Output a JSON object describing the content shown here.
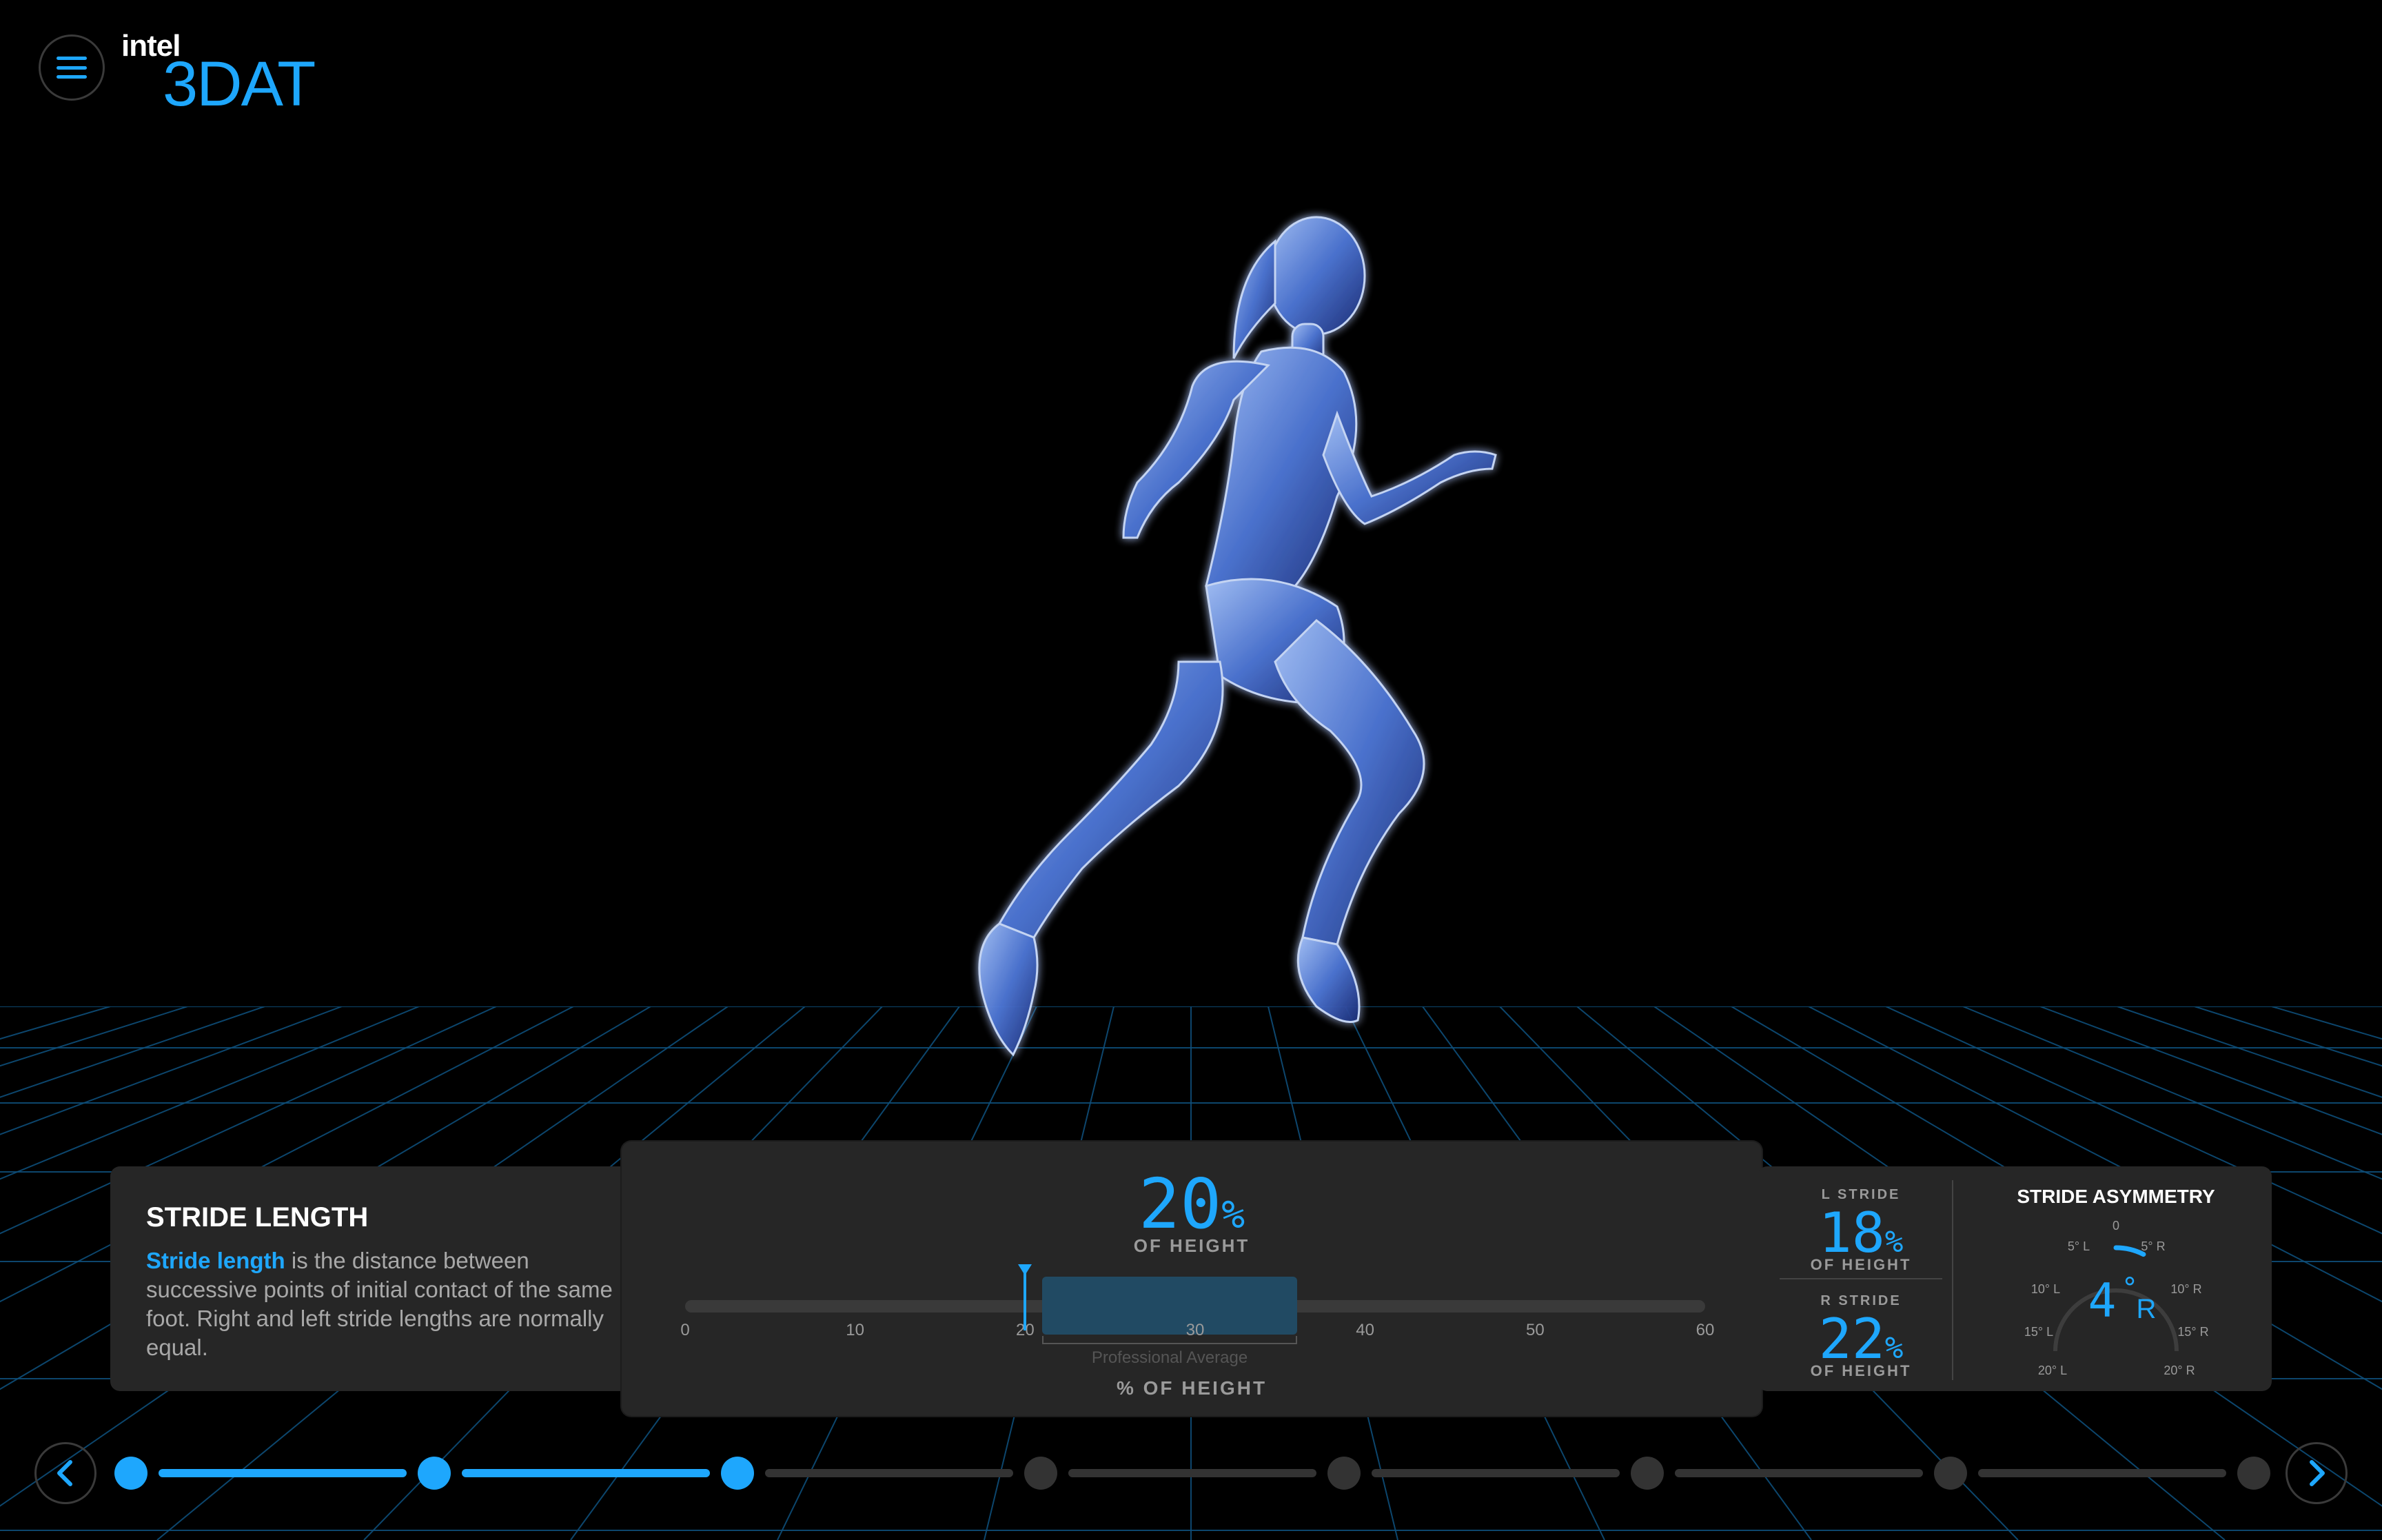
{
  "header": {
    "brand_intel": "intel",
    "brand_product": "3DAT",
    "menu_icon": "hamburger-icon"
  },
  "metric": {
    "title": "STRIDE LENGTH",
    "description_highlight": "Stride length",
    "description_rest": " is the distance between successive points of initial contact of the same foot. Right and left stride lengths are normally equal."
  },
  "center_panel": {
    "value": "20",
    "unit": "%",
    "sub_label": "OF HEIGHT",
    "scale_ticks": [
      "0",
      "10",
      "20",
      "30",
      "40",
      "50",
      "60"
    ],
    "marker_value": 20,
    "professional_range": [
      21,
      36
    ],
    "professional_label": "Professional Average",
    "axis_label": "% OF HEIGHT"
  },
  "right_panel": {
    "l_stride": {
      "label": "L STRIDE",
      "value": "18",
      "unit": "%",
      "sub_label": "OF HEIGHT"
    },
    "r_stride": {
      "label": "R STRIDE",
      "value": "22",
      "unit": "%",
      "sub_label": "OF HEIGHT"
    },
    "asymmetry": {
      "title": "STRIDE ASYMMETRY",
      "value": "4",
      "degree_symbol": "°",
      "side": "R",
      "ticks_left": [
        "5° L",
        "10° L",
        "15° L",
        "20° L"
      ],
      "ticks_right": [
        "5° R",
        "10° R",
        "15° R",
        "20° R"
      ],
      "tick_zero": "0"
    }
  },
  "progress": {
    "prev_icon": "chevron-left-icon",
    "next_icon": "chevron-right-icon",
    "steps_total": 8,
    "steps_completed": 3,
    "accent": "#1ea7fd",
    "inactive": "#333333"
  }
}
